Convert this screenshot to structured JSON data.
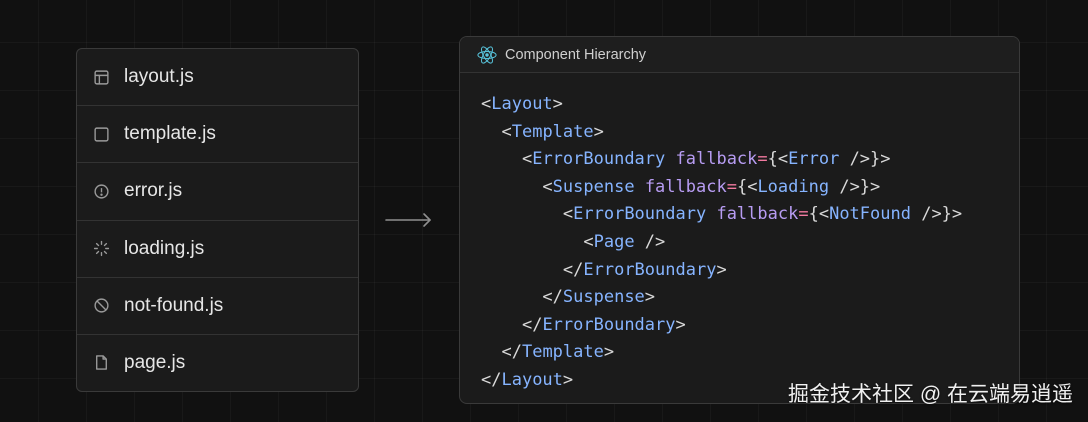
{
  "files": [
    {
      "icon": "layout-icon",
      "name": "layout.js"
    },
    {
      "icon": "template-icon",
      "name": "template.js"
    },
    {
      "icon": "error-icon",
      "name": "error.js"
    },
    {
      "icon": "loading-icon",
      "name": "loading.js"
    },
    {
      "icon": "not-found-icon",
      "name": "not-found.js"
    },
    {
      "icon": "page-icon",
      "name": "page.js"
    }
  ],
  "arrow": {
    "icon": "arrow-right-icon"
  },
  "panel": {
    "icon": "react-icon",
    "title": "Component Hierarchy",
    "code": [
      {
        "indent": "",
        "tokens": [
          {
            "t": "<",
            "c": "punct"
          },
          {
            "t": "Layout",
            "c": "tag"
          },
          {
            "t": ">",
            "c": "punct"
          }
        ]
      },
      {
        "indent": "  ",
        "tokens": [
          {
            "t": "<",
            "c": "punct"
          },
          {
            "t": "Template",
            "c": "tag"
          },
          {
            "t": ">",
            "c": "punct"
          }
        ]
      },
      {
        "indent": "    ",
        "tokens": [
          {
            "t": "<",
            "c": "punct"
          },
          {
            "t": "ErrorBoundary",
            "c": "tag"
          },
          {
            "t": " ",
            "c": "punct"
          },
          {
            "t": "fallback",
            "c": "attr"
          },
          {
            "t": "=",
            "c": "eq"
          },
          {
            "t": "{<",
            "c": "punct"
          },
          {
            "t": "Error",
            "c": "tag"
          },
          {
            "t": " />}>",
            "c": "punct"
          }
        ]
      },
      {
        "indent": "      ",
        "tokens": [
          {
            "t": "<",
            "c": "punct"
          },
          {
            "t": "Suspense",
            "c": "tag"
          },
          {
            "t": " ",
            "c": "punct"
          },
          {
            "t": "fallback",
            "c": "attr"
          },
          {
            "t": "=",
            "c": "eq"
          },
          {
            "t": "{<",
            "c": "punct"
          },
          {
            "t": "Loading",
            "c": "tag"
          },
          {
            "t": " />}>",
            "c": "punct"
          }
        ]
      },
      {
        "indent": "        ",
        "tokens": [
          {
            "t": "<",
            "c": "punct"
          },
          {
            "t": "ErrorBoundary",
            "c": "tag"
          },
          {
            "t": " ",
            "c": "punct"
          },
          {
            "t": "fallback",
            "c": "attr"
          },
          {
            "t": "=",
            "c": "eq"
          },
          {
            "t": "{<",
            "c": "punct"
          },
          {
            "t": "NotFound",
            "c": "tag"
          },
          {
            "t": " />}>",
            "c": "punct"
          }
        ]
      },
      {
        "indent": "          ",
        "tokens": [
          {
            "t": "<",
            "c": "punct"
          },
          {
            "t": "Page",
            "c": "tag"
          },
          {
            "t": " />",
            "c": "punct"
          }
        ]
      },
      {
        "indent": "        ",
        "tokens": [
          {
            "t": "</",
            "c": "punct"
          },
          {
            "t": "ErrorBoundary",
            "c": "tag"
          },
          {
            "t": ">",
            "c": "punct"
          }
        ]
      },
      {
        "indent": "      ",
        "tokens": [
          {
            "t": "</",
            "c": "punct"
          },
          {
            "t": "Suspense",
            "c": "tag"
          },
          {
            "t": ">",
            "c": "punct"
          }
        ]
      },
      {
        "indent": "    ",
        "tokens": [
          {
            "t": "</",
            "c": "punct"
          },
          {
            "t": "ErrorBoundary",
            "c": "tag"
          },
          {
            "t": ">",
            "c": "punct"
          }
        ]
      },
      {
        "indent": "  ",
        "tokens": [
          {
            "t": "</",
            "c": "punct"
          },
          {
            "t": "Template",
            "c": "tag"
          },
          {
            "t": ">",
            "c": "punct"
          }
        ]
      },
      {
        "indent": "",
        "tokens": [
          {
            "t": "</",
            "c": "punct"
          },
          {
            "t": "Layout",
            "c": "tag"
          },
          {
            "t": ">",
            "c": "punct"
          }
        ]
      }
    ]
  },
  "watermark": "掘金技术社区 @ 在云端易逍遥",
  "colors": {
    "background": "#111111",
    "card": "#1b1b1b",
    "border": "#3a3a3a",
    "tag": "#86b4ff",
    "attr": "#b79cf2",
    "equals": "#f27aa0",
    "text": "#e6e6e6",
    "react": "#58c4dc"
  }
}
